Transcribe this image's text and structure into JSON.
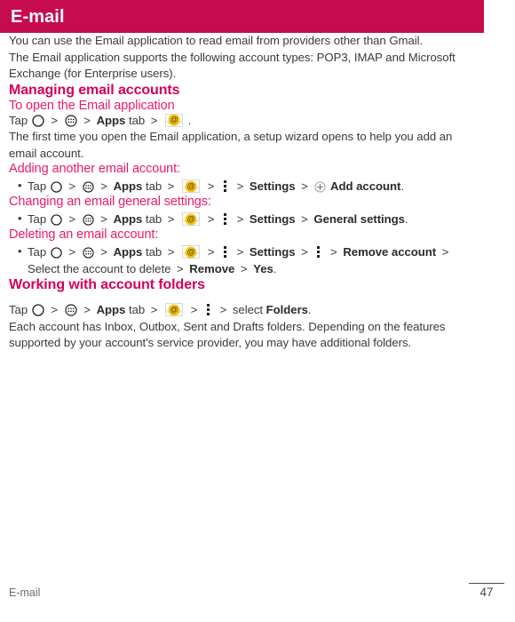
{
  "header": {
    "title": "E-mail",
    "bar_color": "#c60b4f"
  },
  "intro": {
    "line1": "You can use the Email application to read email from providers other than Gmail.",
    "line2": "The Email application supports the following account types: POP3, IMAP and Microsoft",
    "line3": "Exchange (for Enterprise users)."
  },
  "sections": {
    "managing": {
      "heading": "Managing email accounts",
      "open_app": {
        "subheading": "To open the Email application",
        "tap_label": "Tap",
        "sep": ">",
        "apps_bold": "Apps",
        "tab_word": "tab",
        "period": ".",
        "note_line1": "The first time you open the Email application, a setup wizard opens to help you add an",
        "note_line2": "email account."
      },
      "adding": {
        "subheading": "Adding another email account:",
        "tap_label": "Tap",
        "apps_bold": "Apps",
        "tab_word": "tab",
        "settings_bold": "Settings",
        "add_account_bold": "Add account",
        "period": "."
      },
      "changing": {
        "subheading": "Changing an email general settings:",
        "tap_label": "Tap",
        "apps_bold": "Apps",
        "tab_word": "tab",
        "settings_bold": "Settings",
        "general_settings_bold": "General settings",
        "period": "."
      },
      "deleting": {
        "subheading": "Deleting an email account:",
        "tap_label": "Tap",
        "apps_bold": "Apps",
        "tab_word": "tab",
        "settings_bold": "Settings",
        "remove_account_bold": "Remove account",
        "select_text": "Select the account to delete",
        "remove_bold": "Remove",
        "yes_bold": "Yes",
        "period": "."
      }
    },
    "folders": {
      "heading": "Working with account folders",
      "tap_label": "Tap",
      "apps_bold": "Apps",
      "tab_word": "tab",
      "select_word": "select",
      "folders_bold": "Folders",
      "period": ".",
      "note_line1": "Each account has Inbox, Outbox, Sent and Drafts folders. Depending on the features",
      "note_line2": "supported by your account's service provider, you may have additional folders."
    }
  },
  "icons": {
    "home": "home-circle-icon",
    "apps": "apps-grid-icon",
    "email": "email-at-icon",
    "at_glyph": "@",
    "overflow": "overflow-menu-icon",
    "plus": "add-plus-icon"
  },
  "footer": {
    "label": "E-mail",
    "page_number": "47"
  }
}
